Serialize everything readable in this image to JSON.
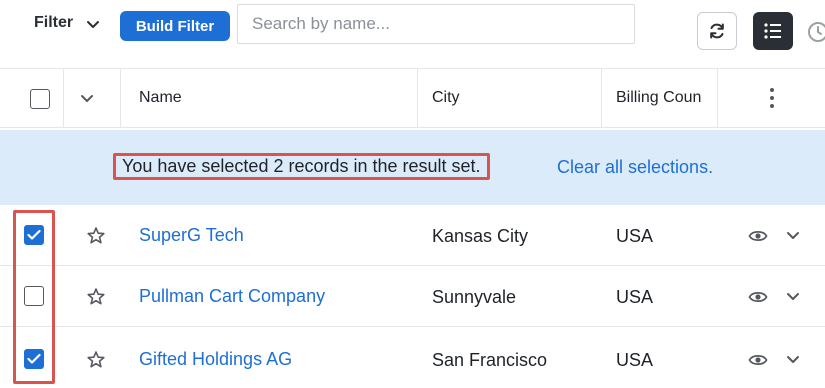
{
  "toolbar": {
    "filter_label": "Filter",
    "build_filter_label": "Build Filter",
    "search_placeholder": "Search by name...",
    "icons": [
      "refresh-icon",
      "list-view-icon",
      "clock-icon"
    ]
  },
  "table": {
    "columns": [
      "Name",
      "City",
      "Billing Coun"
    ],
    "rows": [
      {
        "name": "SuperG Tech",
        "city": "Kansas City",
        "country": "USA",
        "selected": true
      },
      {
        "name": "Pullman Cart Company",
        "city": "Sunnyvale",
        "country": "USA",
        "selected": false
      },
      {
        "name": "Gifted Holdings AG",
        "city": "San Francisco",
        "country": "USA",
        "selected": true
      }
    ]
  },
  "banner": {
    "message": "You have selected 2 records in the result set.",
    "link": "Clear all selections."
  },
  "colors": {
    "accent": "#1d6fd6",
    "banner_bg": "#dcebfa",
    "highlight": "#d9534f"
  }
}
